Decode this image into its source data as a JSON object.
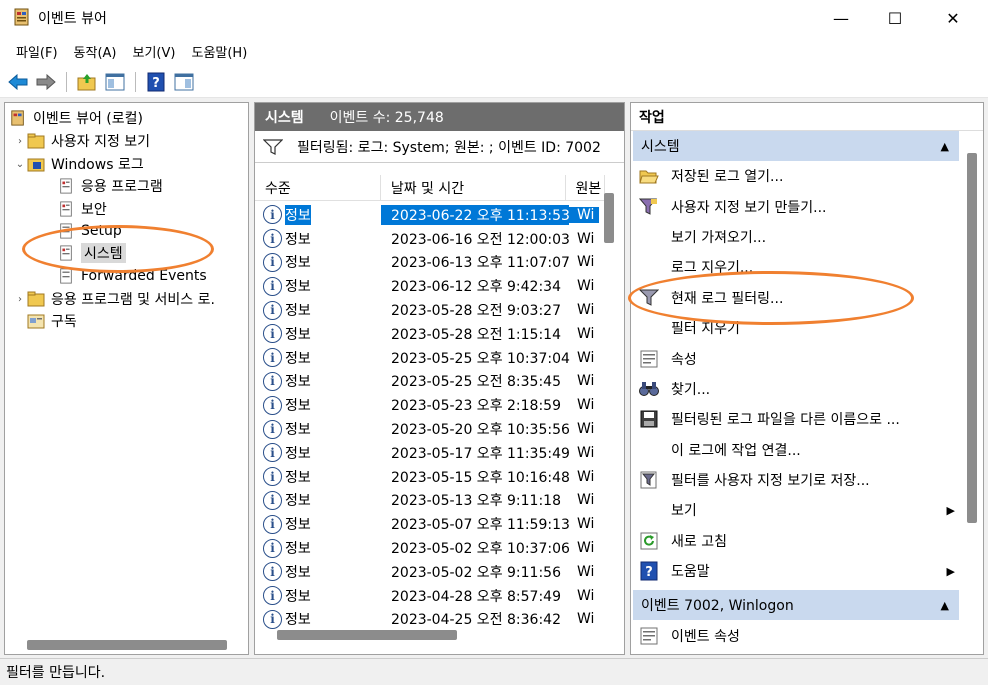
{
  "window": {
    "title": "이벤트 뷰어",
    "minimize": "—",
    "maximize": "☐",
    "close": "✕"
  },
  "menu": [
    "파일(F)",
    "동작(A)",
    "보기(V)",
    "도움말(H)"
  ],
  "tree": {
    "items": [
      {
        "label": "이벤트 뷰어 (로컬)",
        "chev": ""
      },
      {
        "label": "사용자 지정 보기",
        "chev": "›"
      },
      {
        "label": "Windows 로그",
        "chev": "⌄"
      },
      {
        "label": "응용 프로그램",
        "chev": ""
      },
      {
        "label": "보안",
        "chev": ""
      },
      {
        "label": "Setup",
        "chev": ""
      },
      {
        "label": "시스템",
        "chev": ""
      },
      {
        "label": "Forwarded Events",
        "chev": ""
      },
      {
        "label": "응용 프로그램 및 서비스 로.",
        "chev": "›"
      },
      {
        "label": "구독",
        "chev": ""
      }
    ]
  },
  "middle": {
    "header_name": "시스템",
    "header_count": "이벤트 수: 25,748",
    "filter_text": "필터링됨: 로그: System; 원본: ; 이벤트 ID: 7002",
    "columns": [
      "수준",
      "날짜 및 시간",
      "원본"
    ],
    "rows": [
      {
        "level": "정보",
        "datetime": "2023-06-22 오후 11:13:53",
        "source": "Wi"
      },
      {
        "level": "정보",
        "datetime": "2023-06-16 오전 12:00:03",
        "source": "Wi"
      },
      {
        "level": "정보",
        "datetime": "2023-06-13 오후 11:07:07",
        "source": "Wi"
      },
      {
        "level": "정보",
        "datetime": "2023-06-12 오후 9:42:34",
        "source": "Wi"
      },
      {
        "level": "정보",
        "datetime": "2023-05-28 오전 9:03:27",
        "source": "Wi"
      },
      {
        "level": "정보",
        "datetime": "2023-05-28 오전 1:15:14",
        "source": "Wi"
      },
      {
        "level": "정보",
        "datetime": "2023-05-25 오후 10:37:04",
        "source": "Wi"
      },
      {
        "level": "정보",
        "datetime": "2023-05-25 오전 8:35:45",
        "source": "Wi"
      },
      {
        "level": "정보",
        "datetime": "2023-05-23 오후 2:18:59",
        "source": "Wi"
      },
      {
        "level": "정보",
        "datetime": "2023-05-20 오후 10:35:56",
        "source": "Wi"
      },
      {
        "level": "정보",
        "datetime": "2023-05-17 오후 11:35:49",
        "source": "Wi"
      },
      {
        "level": "정보",
        "datetime": "2023-05-15 오후 10:16:48",
        "source": "Wi"
      },
      {
        "level": "정보",
        "datetime": "2023-05-13 오후 9:11:18",
        "source": "Wi"
      },
      {
        "level": "정보",
        "datetime": "2023-05-07 오후 11:59:13",
        "source": "Wi"
      },
      {
        "level": "정보",
        "datetime": "2023-05-02 오후 10:37:06",
        "source": "Wi"
      },
      {
        "level": "정보",
        "datetime": "2023-05-02 오후 9:11:56",
        "source": "Wi"
      },
      {
        "level": "정보",
        "datetime": "2023-04-28 오후 8:57:49",
        "source": "Wi"
      },
      {
        "level": "정보",
        "datetime": "2023-04-25 오전 8:36:42",
        "source": "Wi"
      }
    ]
  },
  "actions": {
    "title": "작업",
    "section1": "시스템",
    "items": [
      {
        "label": "저장된 로그 열기...",
        "icon": "folder-open-icon",
        "arrow": ""
      },
      {
        "label": "사용자 지정 보기 만들기...",
        "icon": "filter-create-icon",
        "arrow": ""
      },
      {
        "label": "보기 가져오기...",
        "icon": "",
        "arrow": ""
      },
      {
        "label": "로그 지우기...",
        "icon": "",
        "arrow": ""
      },
      {
        "label": "현재 로그 필터링...",
        "icon": "filter-icon",
        "arrow": ""
      },
      {
        "label": "필터 지우기",
        "icon": "",
        "arrow": ""
      },
      {
        "label": "속성",
        "icon": "properties-icon",
        "arrow": ""
      },
      {
        "label": "찾기...",
        "icon": "binoculars-icon",
        "arrow": ""
      },
      {
        "label": "필터링된 로그 파일을 다른 이름으로 ...",
        "icon": "save-icon",
        "arrow": ""
      },
      {
        "label": "이 로그에 작업 연결...",
        "icon": "",
        "arrow": ""
      },
      {
        "label": "필터를 사용자 지정 보기로 저장...",
        "icon": "filter-save-icon",
        "arrow": ""
      },
      {
        "label": "보기",
        "icon": "",
        "arrow": "▶"
      },
      {
        "label": "새로 고침",
        "icon": "refresh-icon",
        "arrow": ""
      },
      {
        "label": "도움말",
        "icon": "help-icon",
        "arrow": "▶"
      }
    ],
    "section2": "이벤트 7002, Winlogon",
    "items2": [
      {
        "label": "이벤트 속성",
        "icon": "properties-icon"
      }
    ]
  },
  "status": "필터를 만듭니다.",
  "colors": {
    "selection": "#0078d7",
    "section_header": "#c9d9ee",
    "annotation": "#f08030",
    "panel_header": "#6d6d6d"
  }
}
